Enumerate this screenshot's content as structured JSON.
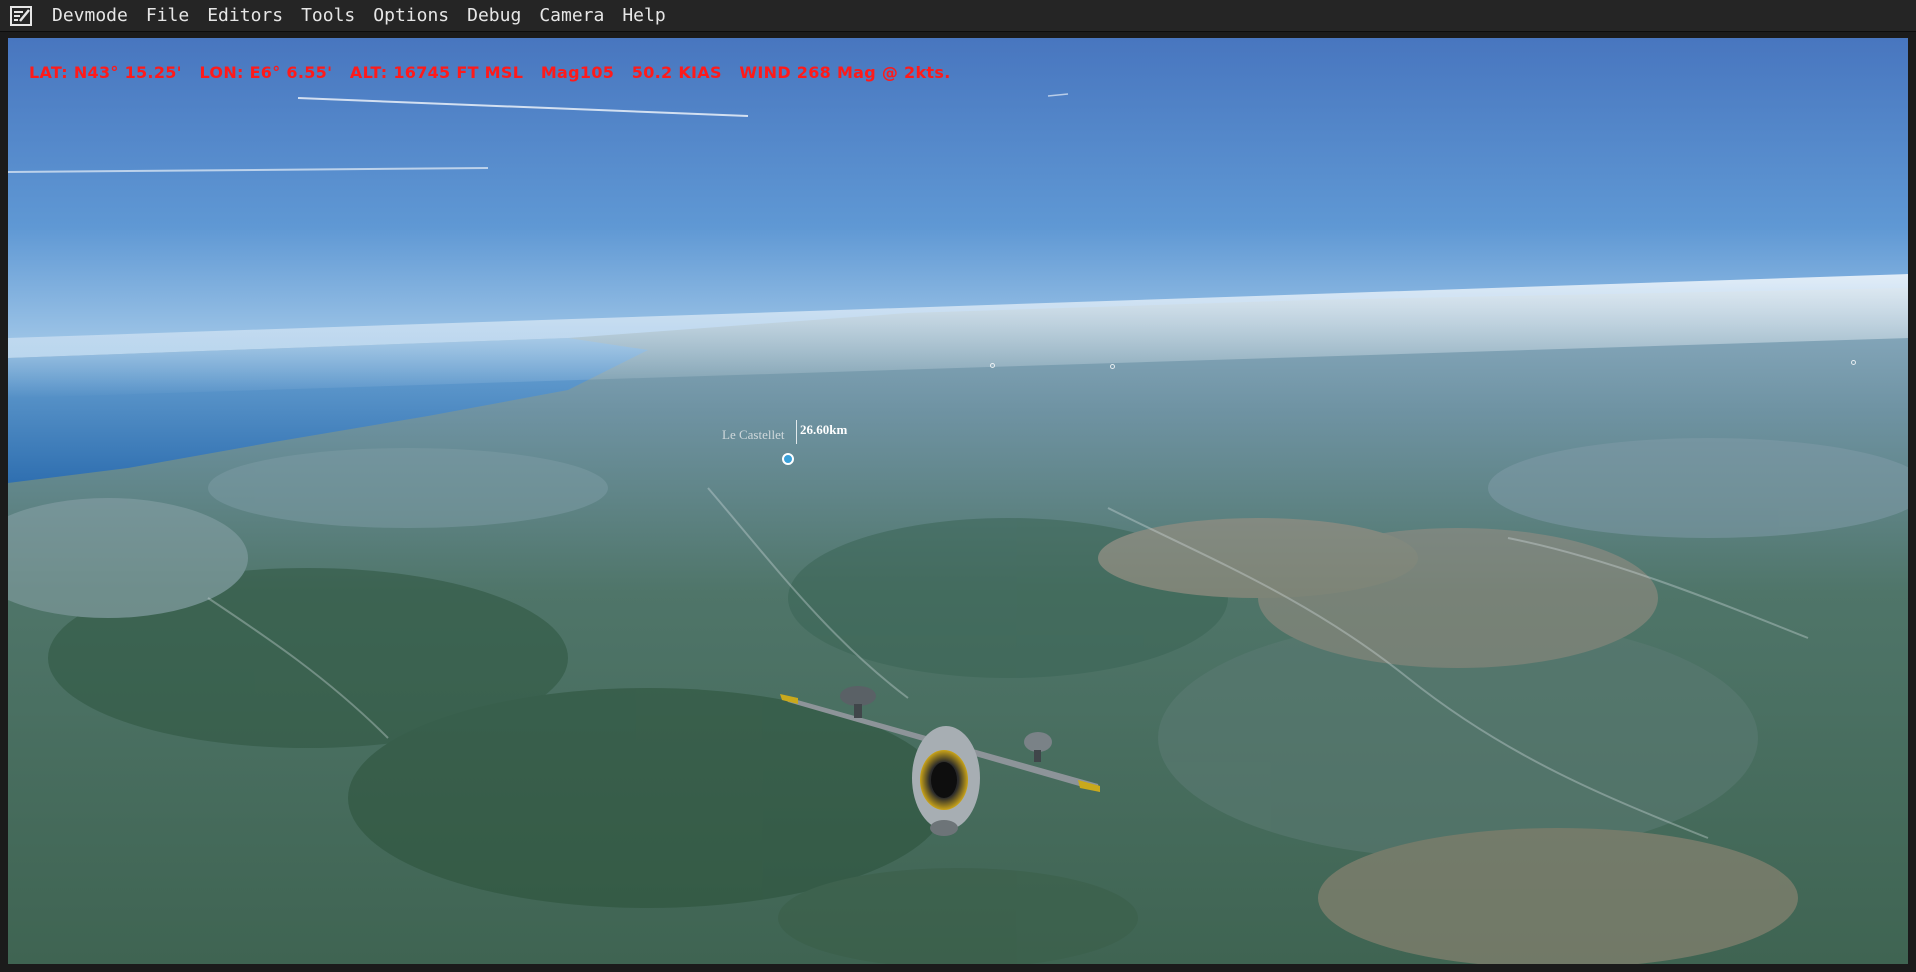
{
  "menubar": {
    "logo_icon": "editor-logo-icon",
    "items": [
      {
        "label": "Devmode"
      },
      {
        "label": "File"
      },
      {
        "label": "Editors"
      },
      {
        "label": "Tools"
      },
      {
        "label": "Options"
      },
      {
        "label": "Debug"
      },
      {
        "label": "Camera"
      },
      {
        "label": "Help"
      }
    ]
  },
  "hud": {
    "text": "LAT: N43° 15.25'   LON: E6° 6.55'   ALT: 16745 FT MSL   Mag105   50.2 KIAS   WIND 268 Mag @ 2kts.",
    "color": "#ff1a1a"
  },
  "poi": {
    "name": "Le Castellet",
    "distance": "26.60km",
    "icon": "location-pin-icon"
  },
  "colors": {
    "sky_top": "#4a7dc3",
    "sky_horizon": "#e2eef7",
    "sea": "#3d7fbf",
    "land": "#4a7060"
  }
}
